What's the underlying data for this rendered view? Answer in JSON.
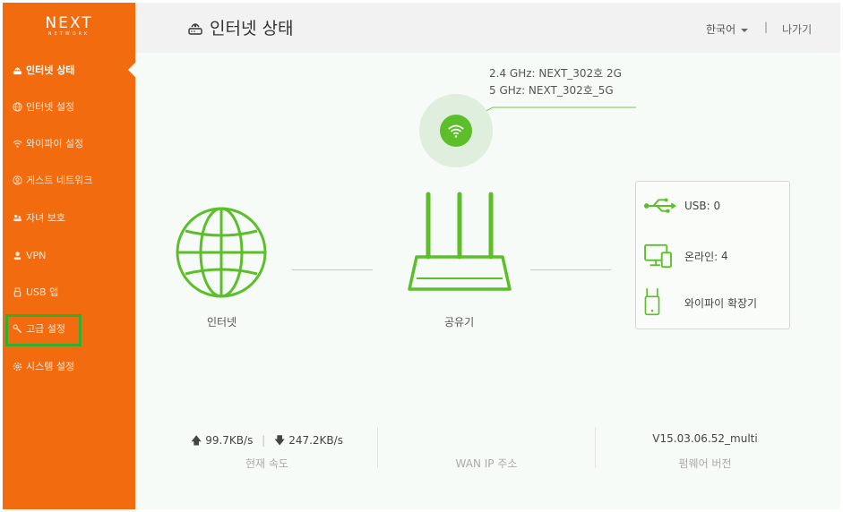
{
  "sidebar": {
    "logo_main": "NEXT",
    "logo_sub": "NETWORK",
    "items": [
      {
        "label": "인터넷 상태",
        "icon": "router-icon"
      },
      {
        "label": "인터넷 설정",
        "icon": "globe-icon"
      },
      {
        "label": "와이파이 설정",
        "icon": "wifi-icon"
      },
      {
        "label": "게스트 네트워크",
        "icon": "guest-icon"
      },
      {
        "label": "자녀 보호",
        "icon": "parental-icon"
      },
      {
        "label": "VPN",
        "icon": "vpn-icon"
      },
      {
        "label": "USB 앱",
        "icon": "usb-icon"
      },
      {
        "label": "고급 설정",
        "icon": "wrench-icon"
      },
      {
        "label": "시스템 설정",
        "icon": "gear-icon"
      }
    ]
  },
  "header": {
    "title": "인터넷 상태",
    "language": "한국어",
    "separator": "|",
    "logout": "나가기"
  },
  "wifi": {
    "ssid_24": "2.4 GHz: NEXT_302호 2G",
    "ssid_5": "5 GHz: NEXT_302호_5G"
  },
  "topology": {
    "internet_label": "인터넷",
    "router_label": "공유기"
  },
  "devices": {
    "usb_label": "USB:",
    "usb_count": "0",
    "online_label": "온라인:",
    "online_count": "4",
    "extender_label": "와이파이 확장기"
  },
  "stats": {
    "upload": "99.7KB/s",
    "divider": "|",
    "download": "247.2KB/s",
    "speed_label": "현재 속도",
    "wan_value": "",
    "wan_label": "WAN IP 주소",
    "firmware_value": "V15.03.06.52_multi",
    "firmware_label": "펌웨어 버전"
  },
  "colors": {
    "sidebar_bg": "#f26b0f",
    "accent_green": "#5cbf2a",
    "highlight": "#2fae2f"
  }
}
